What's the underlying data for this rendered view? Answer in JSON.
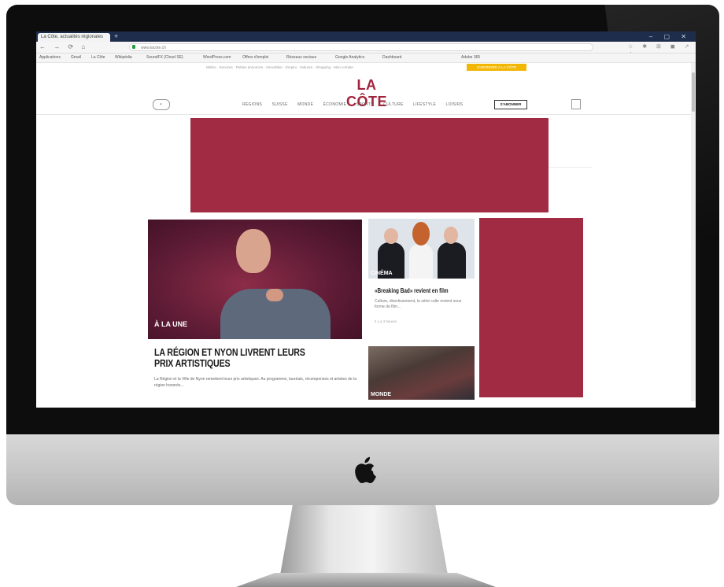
{
  "browser": {
    "tab_title": "La Côte, actualités régionales",
    "new_tab": "+",
    "window_controls": "– ▢ ✕",
    "nav_buttons": "← → ⟳ ⌂",
    "url": "www.lacote.ch",
    "extensions": "☆ ✱ ⊞ ◼ ↗ ⋮",
    "bookmarks": [
      "Applications",
      "Gmail",
      "La Côte",
      "Wikipédia",
      "SoundFX (Cloud SE)",
      "WordPress.com",
      "Offres d'emploi",
      "Réseaux sociaux",
      "Google Analytics",
      "Dashboard",
      "Adobe 365"
    ]
  },
  "site": {
    "top_links": "Météo · Services · Petites annonces · Immobilier · Emploi · Voitures · Shopping · Mon compte",
    "top_cta": "S'ABONNER À LA CÔTE",
    "logo": "LA CÔTE",
    "nav": [
      "RÉGIONS",
      "SUISSE",
      "MONDE",
      "ÉCONOMIE",
      "SPORTS",
      "CULTURE",
      "LIFESTYLE",
      "LOISIRS"
    ],
    "subscribe_label": "S'ABONNER",
    "feature": {
      "tag": "À LA UNE",
      "title": "LA RÉGION ET NYON LIVRENT LEURS PRIX ARTISTIQUES",
      "excerpt": "La Région et la Ville de Nyon remettent leurs prix artistiques. Au programme, lauréats, récompenses et artistes de la région honorés..."
    },
    "card1": {
      "tag": "CINÉMA",
      "title": "«Breaking Bad» revient en film",
      "excerpt": "Culture, divertissement, la série culte revient sous forme de film...",
      "meta": "Il y a 3 heures"
    },
    "card2": {
      "tag": "MONDE"
    }
  },
  "colors": {
    "brand": "#a0243b",
    "ad_block": "#a02b42",
    "cta": "#f2b705",
    "tab_bar": "#1f2d4d"
  }
}
